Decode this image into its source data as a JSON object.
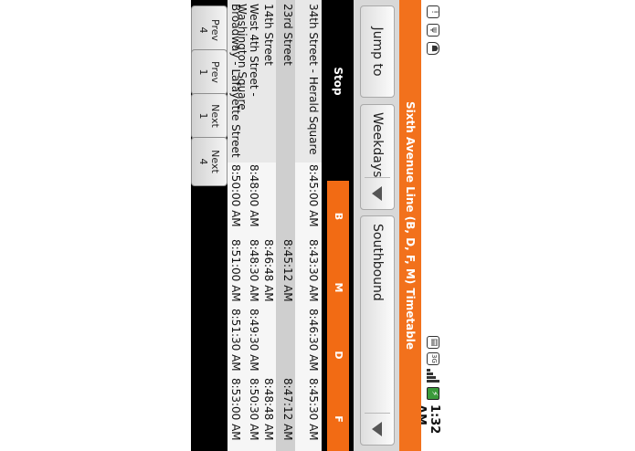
{
  "status": {
    "time": "1:32 AM",
    "left_icons": [
      "notification-icon",
      "usb-icon",
      "android-debug-icon"
    ],
    "right_icons": [
      "screenshot-icon",
      "3g-network-icon",
      "signal-icon",
      "battery-charging-icon"
    ]
  },
  "title": "Sixth Avenue Line (B, D, F, M) Timetable",
  "controls": {
    "day_selected": "Weekdays",
    "direction_selected": "Southbound"
  },
  "table": {
    "stop_header": "Stop",
    "routes": [
      "B",
      "M",
      "D",
      "F"
    ],
    "rows": [
      {
        "stop": "34th Street - Herald Square",
        "times": [
          "8:45:00 AM",
          "8:43:30 AM",
          "8:46:30 AM",
          "8:45:30 AM"
        ]
      },
      {
        "stop": "23rd Street",
        "times": [
          "",
          "8:45:12 AM",
          "",
          "8:47:12 AM"
        ]
      },
      {
        "stop": "14th Street",
        "times": [
          "",
          "8:46:48 AM",
          "",
          "8:48:48 AM"
        ]
      },
      {
        "stop": "West 4th Street - Washington Square",
        "times": [
          "8:48:00 AM",
          "8:48:30 AM",
          "8:49:30 AM",
          "8:50:30 AM"
        ]
      },
      {
        "stop": "Broadway - Lafayette Street",
        "times": [
          "8:50:00 AM",
          "8:51:00 AM",
          "8:51:30 AM",
          "8:53:00 AM"
        ]
      }
    ]
  },
  "buttons": {
    "jump": "Jump to",
    "prev4": [
      "Prev",
      "4"
    ],
    "prev1": [
      "Prev",
      "1"
    ],
    "next1": [
      "Next",
      "1"
    ],
    "next4": [
      "Next",
      "4"
    ]
  },
  "colors": {
    "accent": "#f2711c"
  }
}
